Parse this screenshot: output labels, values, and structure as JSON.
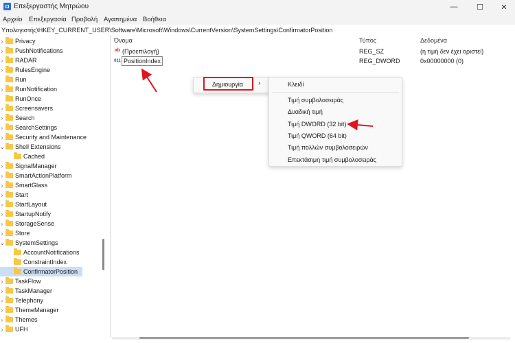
{
  "window": {
    "title": "Επεξεργαστής Μητρώου",
    "minimize_glyph": "—",
    "maximize_glyph": "☐",
    "close_glyph": "✕"
  },
  "menubar": {
    "items": [
      "Αρχείο",
      "Επεξεργασία",
      "Προβολή",
      "Αγαπημένα",
      "Βοήθεια"
    ]
  },
  "address": {
    "path": "Υπολογιστής\\HKEY_CURRENT_USER\\Software\\Microsoft\\Windows\\CurrentVersion\\SystemSettings\\ConfirmatorPosition"
  },
  "tree": {
    "items": [
      {
        "label": "Privacy",
        "level": 0,
        "expandable": true
      },
      {
        "label": "PushNotifications",
        "level": 0,
        "expandable": true
      },
      {
        "label": "RADAR",
        "level": 0,
        "expandable": true
      },
      {
        "label": "RulesEngine",
        "level": 0,
        "expandable": true
      },
      {
        "label": "Run",
        "level": 0,
        "expandable": false
      },
      {
        "label": "RunNotification",
        "level": 0,
        "expandable": true
      },
      {
        "label": "RunOnce",
        "level": 0,
        "expandable": false
      },
      {
        "label": "Screensavers",
        "level": 0,
        "expandable": true
      },
      {
        "label": "Search",
        "level": 0,
        "expandable": true
      },
      {
        "label": "SearchSettings",
        "level": 0,
        "expandable": true
      },
      {
        "label": "Security and Maintenance",
        "level": 0,
        "expandable": true
      },
      {
        "label": "Shell Extensions",
        "level": 0,
        "expandable": true,
        "expanded": true
      },
      {
        "label": "Cached",
        "level": 1,
        "expandable": false
      },
      {
        "label": "SignalManager",
        "level": 0,
        "expandable": true
      },
      {
        "label": "SmartActionPlatform",
        "level": 0,
        "expandable": true
      },
      {
        "label": "SmartGlass",
        "level": 0,
        "expandable": true
      },
      {
        "label": "Start",
        "level": 0,
        "expandable": true
      },
      {
        "label": "StartLayout",
        "level": 0,
        "expandable": true
      },
      {
        "label": "StartupNotify",
        "level": 0,
        "expandable": true
      },
      {
        "label": "StorageSense",
        "level": 0,
        "expandable": true
      },
      {
        "label": "Store",
        "level": 0,
        "expandable": true
      },
      {
        "label": "SystemSettings",
        "level": 0,
        "expandable": true,
        "expanded": true
      },
      {
        "label": "AccountNotifications",
        "level": 1,
        "expandable": false
      },
      {
        "label": "ConstraintIndex",
        "level": 1,
        "expandable": false
      },
      {
        "label": "ConfirmatorPosition",
        "level": 1,
        "expandable": false,
        "selected": true
      },
      {
        "label": "TaskFlow",
        "level": 0,
        "expandable": true
      },
      {
        "label": "TaskManager",
        "level": 0,
        "expandable": true
      },
      {
        "label": "Telephony",
        "level": 0,
        "expandable": true
      },
      {
        "label": "ThemeManager",
        "level": 0,
        "expandable": true
      },
      {
        "label": "Themes",
        "level": 0,
        "expandable": true
      },
      {
        "label": "UFH",
        "level": 0,
        "expandable": true
      }
    ]
  },
  "list": {
    "headers": {
      "name": "Όνομα",
      "type": "Τύπος",
      "data": "Δεδομένα"
    },
    "rows": [
      {
        "name": "(Προεπιλογή)",
        "type": "REG_SZ",
        "data": "(η τιμή δεν έχει οριστεί)",
        "icon": "string-value-icon",
        "icon_glyph": "ab"
      },
      {
        "name": "PositionIndex",
        "type": "REG_DWORD",
        "data": "0x00000000 (0)",
        "icon": "binary-value-icon",
        "icon_glyph": "011"
      }
    ]
  },
  "context_menu": {
    "new_label": "Δημιουργία",
    "arrow": "›",
    "submenu": [
      "Κλειδί",
      "Τιμή συμβολοσειράς",
      "Δυαδική τιμή",
      "Τιμή DWORD (32 bit)",
      "Τιμή QWORD (64 bit)",
      "Τιμή πολλών συμβολοσειρών",
      "Επεκτάσιμη τιμή συμβολοσειράς"
    ]
  },
  "colors": {
    "annotation_red": "#e0141e",
    "selection": "#ccdef5",
    "folder": "#f6c84a"
  }
}
